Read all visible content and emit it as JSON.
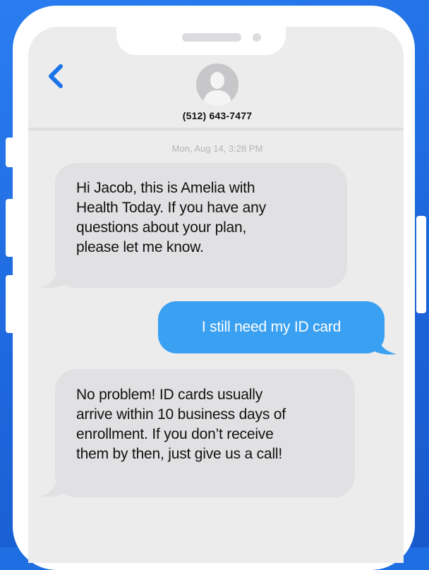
{
  "header": {
    "contact_number": "(512) 643-7477"
  },
  "conversation": {
    "timestamp": "Mon, Aug 14, 3:28 PM",
    "messages": [
      {
        "direction": "incoming",
        "text": "Hi Jacob, this is Amelia with\nHealth Today. If you have any\nquestions about your plan,\nplease let me know."
      },
      {
        "direction": "outgoing",
        "text": "I still need my ID card"
      },
      {
        "direction": "incoming",
        "text": "No problem! ID cards usually\narrive within 10 business days of\nenrollment. If you don’t receive\nthem by then, just give us a call!"
      }
    ]
  },
  "colors": {
    "background": "#1f6fe3",
    "incoming_bubble": "#e1e1e3",
    "outgoing_bubble": "#3aa0f2",
    "back_chevron": "#1a73e8"
  },
  "icons": {
    "back": "chevron-left-icon",
    "avatar": "person-silhouette-icon"
  }
}
